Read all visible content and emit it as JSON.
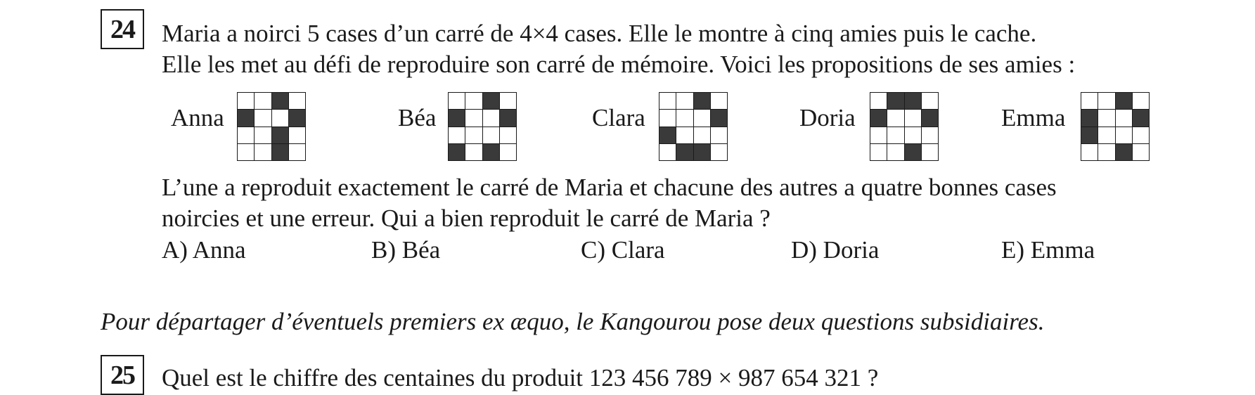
{
  "q24": {
    "number": "24",
    "lines": [
      "Maria a noirci 5 cases d’un carré de 4×4 cases. Elle le montre à cinq amies puis le cache.",
      "Elle les met au défi de reproduire son carré de mémoire. Voici les propositions de ses amies :"
    ],
    "proposals": [
      {
        "name": "Anna",
        "cells": [
          0,
          0,
          1,
          0,
          1,
          0,
          0,
          1,
          0,
          0,
          1,
          0,
          0,
          0,
          1,
          0
        ]
      },
      {
        "name": "Béa",
        "cells": [
          0,
          0,
          1,
          0,
          1,
          0,
          0,
          1,
          0,
          0,
          0,
          0,
          1,
          0,
          1,
          0
        ]
      },
      {
        "name": "Clara",
        "cells": [
          0,
          0,
          1,
          0,
          0,
          0,
          0,
          1,
          1,
          0,
          0,
          0,
          0,
          1,
          1,
          0
        ]
      },
      {
        "name": "Doria",
        "cells": [
          0,
          1,
          1,
          0,
          1,
          0,
          0,
          1,
          0,
          0,
          0,
          0,
          0,
          0,
          1,
          0
        ]
      },
      {
        "name": "Emma",
        "cells": [
          0,
          0,
          1,
          0,
          1,
          0,
          0,
          1,
          1,
          0,
          0,
          0,
          0,
          0,
          1,
          0
        ]
      }
    ],
    "lines_after": [
      "L’une a reproduit exactement le carré de Maria et chacune des autres a quatre bonnes cases",
      "noircies et une erreur. Qui a bien reproduit le carré de Maria ?"
    ],
    "answers": [
      "A) Anna",
      "B) Béa",
      "C) Clara",
      "D) Doria",
      "E) Emma"
    ]
  },
  "intro": "Pour départager d’éventuels premiers ex æquo, le Kangourou pose deux questions subsidiaires.",
  "q25": {
    "number": "25",
    "text": "Quel est le chiffre des centaines du produit 123 456 789 × 987 654 321 ?"
  },
  "colors": {
    "ink": "#1a1a1a",
    "dark_cell": "#3a3a3a"
  }
}
